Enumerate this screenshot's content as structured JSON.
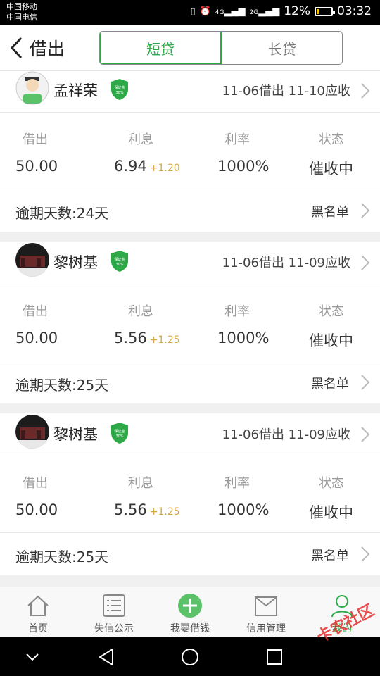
{
  "status_bar": {
    "carrier1": "中国移动",
    "carrier2": "中国电信",
    "network1": "4G",
    "network2": "2G",
    "battery": "12%",
    "battery_level": 0.12,
    "time": "03:32"
  },
  "header": {
    "title": "借出",
    "tabs": [
      {
        "label": "短贷",
        "active": true
      },
      {
        "label": "长贷",
        "active": false
      }
    ]
  },
  "labels": {
    "lend": "借出",
    "interest": "利息",
    "rate": "利率",
    "status": "状态",
    "blacklist": "黑名单"
  },
  "badge_text": "保证金 30%",
  "records": [
    {
      "name": "孟祥荣",
      "dates": "11-06借出 11-10应收",
      "amount": "50.00",
      "interest": "6.94",
      "interest_extra": "+1.20",
      "rate": "1000%",
      "status": "催收中",
      "overdue": "逾期天数:24天"
    },
    {
      "name": "黎树基",
      "dates": "11-06借出 11-09应收",
      "amount": "50.00",
      "interest": "5.56",
      "interest_extra": "+1.25",
      "rate": "1000%",
      "status": "催收中",
      "overdue": "逾期天数:25天"
    },
    {
      "name": "黎树基",
      "dates": "11-06借出 11-09应收",
      "amount": "50.00",
      "interest": "5.56",
      "interest_extra": "+1.25",
      "rate": "1000%",
      "status": "催收中",
      "overdue": "逾期天数:25天"
    }
  ],
  "tabbar": [
    {
      "label": "首页",
      "icon": "home-icon"
    },
    {
      "label": "失信公示",
      "icon": "list-icon"
    },
    {
      "label": "我要借钱",
      "icon": "plus-circle-icon"
    },
    {
      "label": "信用管理",
      "icon": "envelope-icon"
    },
    {
      "label": "我的",
      "icon": "user-icon",
      "active": true
    }
  ],
  "watermark": "卡农社区",
  "colors": {
    "accent": "#2daa47",
    "interest_extra": "#d4a84a",
    "watermark": "#e53030"
  }
}
